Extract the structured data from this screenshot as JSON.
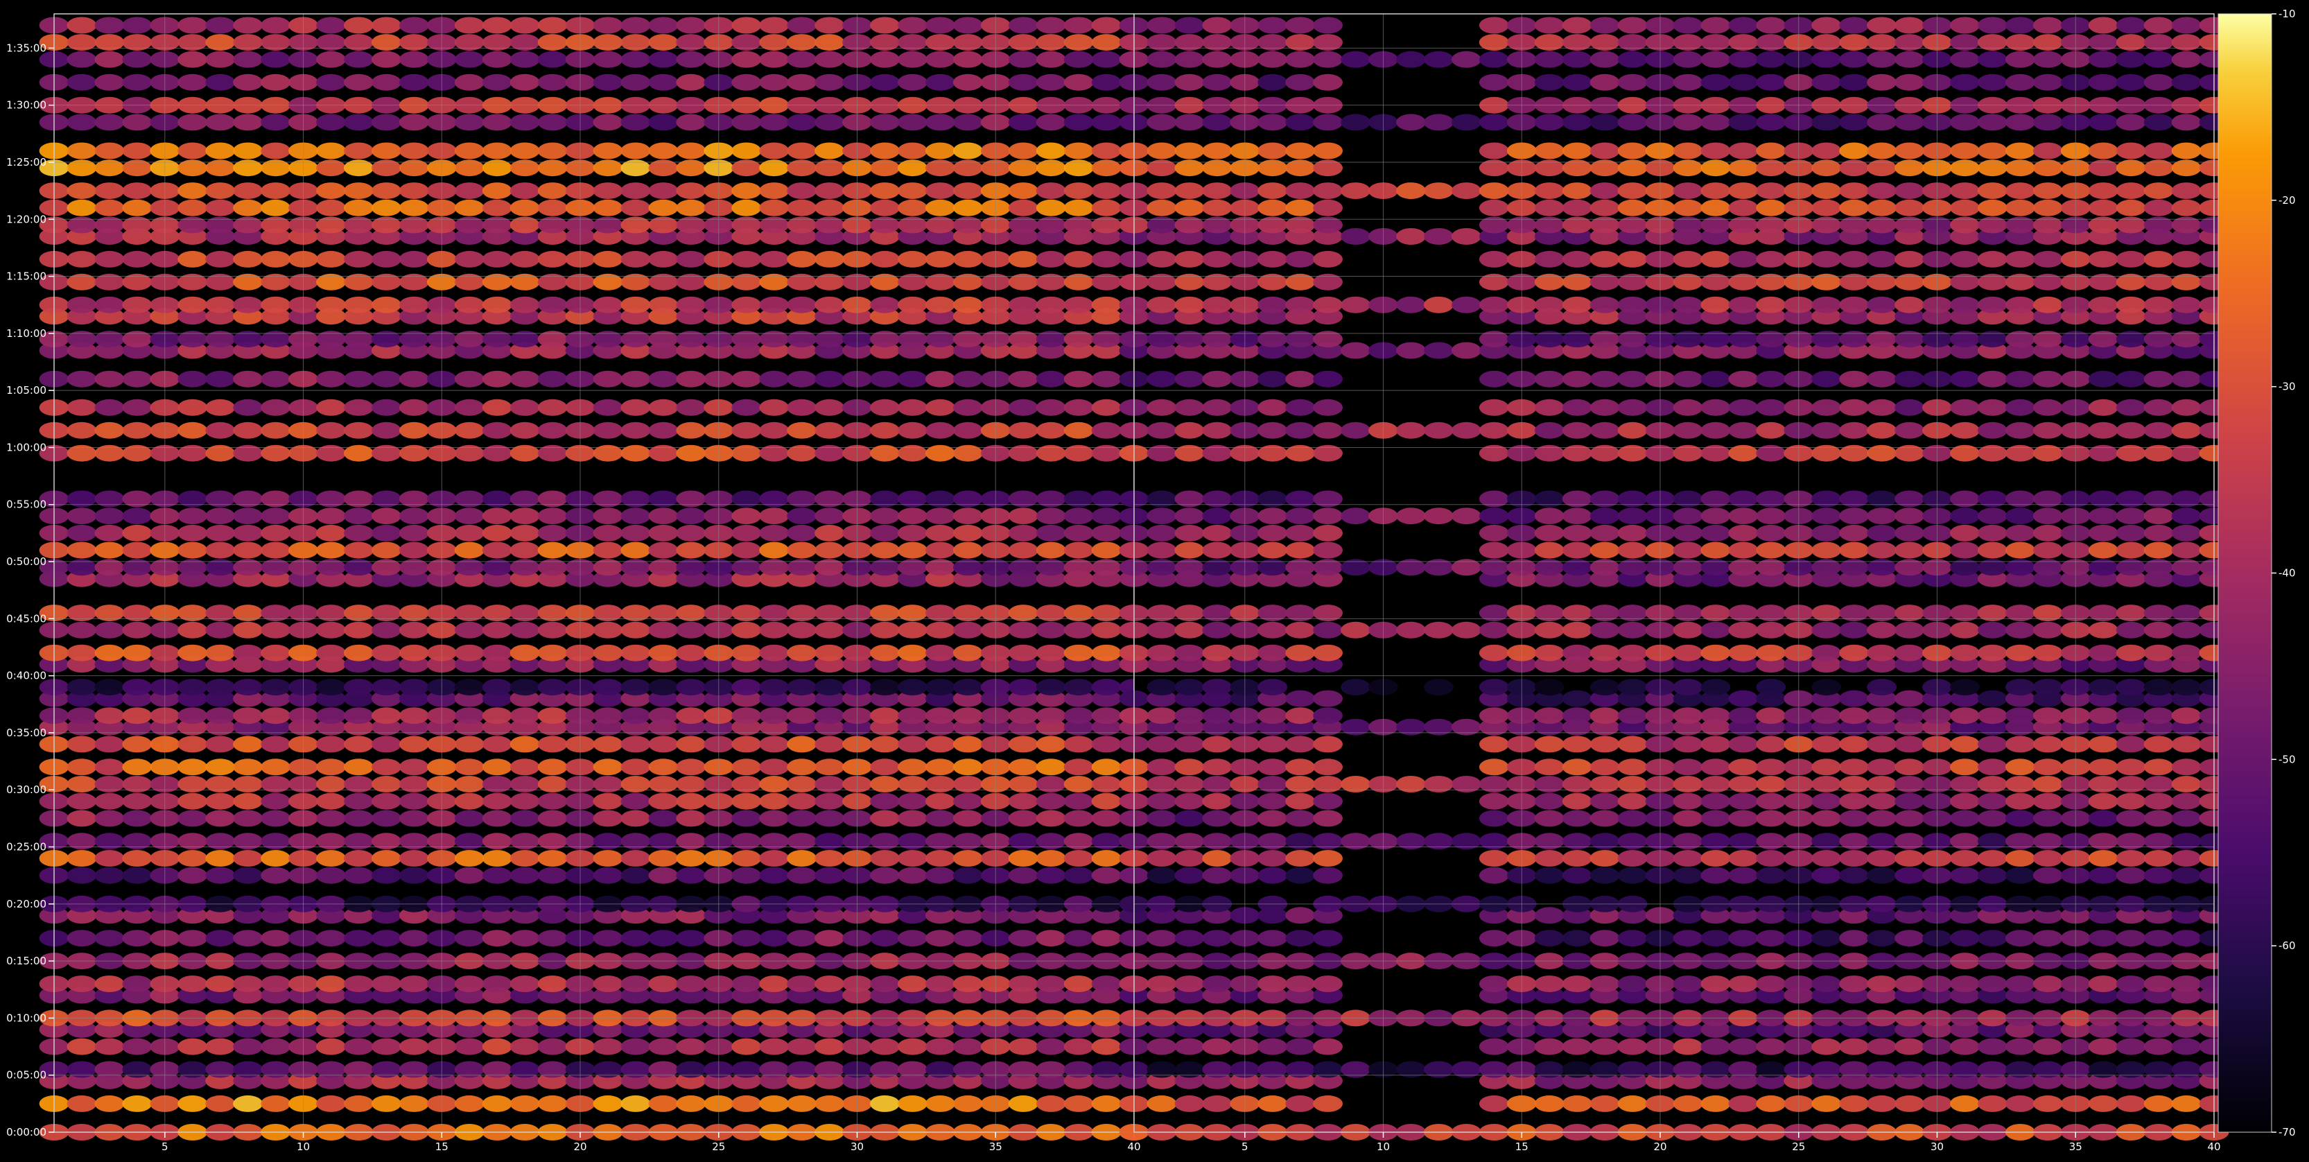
{
  "chart_data": {
    "type": "heatmap",
    "title": "",
    "colormap": "inferno",
    "background": "#000000",
    "grid": true,
    "xlabel": "",
    "ylabel": "",
    "panels": [
      {
        "name": "",
        "xlim": [
          1,
          40
        ],
        "xticks": [
          5,
          10,
          15,
          20,
          25,
          30,
          35,
          40
        ],
        "xtick_labels": [
          "5",
          "10",
          "15",
          "20",
          "25",
          "30",
          "35",
          "40"
        ]
      },
      {
        "name": "",
        "xlim": [
          1,
          40
        ],
        "xticks": [
          5,
          10,
          15,
          20,
          25,
          30,
          35,
          40
        ],
        "xtick_labels": [
          "5",
          "10",
          "15",
          "20",
          "25",
          "30",
          "35",
          "40"
        ]
      }
    ],
    "y_axis": {
      "unit": "time",
      "ylim_seconds": [
        0,
        5880
      ],
      "ticks_seconds": [
        0,
        300,
        600,
        900,
        1200,
        1500,
        1800,
        2100,
        2400,
        2700,
        3000,
        3300,
        3600,
        3900,
        4200,
        4500,
        4800,
        5100,
        5400,
        5700
      ],
      "tick_labels": [
        "0:00:00",
        "0:05:00",
        "0:10:00",
        "0:15:00",
        "0:20:00",
        "0:25:00",
        "0:30:00",
        "0:35:00",
        "0:40:00",
        "0:45:00",
        "0:50:00",
        "0:55:00",
        "1:00:00",
        "1:05:00",
        "1:10:00",
        "1:15:00",
        "1:20:00",
        "1:25:00",
        "1:30:00",
        "1:35:00"
      ]
    },
    "colorbar": {
      "range": [
        -70,
        -10
      ],
      "ticks": [
        -70,
        -60,
        -50,
        -40,
        -30,
        -20,
        -10
      ],
      "tick_labels": [
        "-70",
        "-60",
        "-50",
        "-40",
        "-30",
        "-20",
        "-10"
      ],
      "location": "right"
    },
    "row_levels_panel1": [
      [
        0,
        -26
      ],
      [
        150,
        -22
      ],
      [
        270,
        -40
      ],
      [
        330,
        -52
      ],
      [
        450,
        -38
      ],
      [
        540,
        -46
      ],
      [
        600,
        -32
      ],
      [
        720,
        -46
      ],
      [
        780,
        -38
      ],
      [
        900,
        -42
      ],
      [
        1020,
        -48
      ],
      [
        1140,
        -46
      ],
      [
        1200,
        -58
      ],
      [
        1350,
        -52
      ],
      [
        1440,
        -28
      ],
      [
        1530,
        -48
      ],
      [
        1650,
        -44
      ],
      [
        1740,
        -38
      ],
      [
        1830,
        -34
      ],
      [
        1920,
        -28
      ],
      [
        2040,
        -32
      ],
      [
        2130,
        -44
      ],
      [
        2190,
        -40
      ],
      [
        2280,
        -50
      ],
      [
        2340,
        -60
      ],
      [
        2460,
        -44
      ],
      [
        2520,
        -32
      ],
      [
        2640,
        -38
      ],
      [
        2730,
        -34
      ],
      [
        2910,
        -42
      ],
      [
        2970,
        -46
      ],
      [
        3060,
        -30
      ],
      [
        3150,
        -40
      ],
      [
        3240,
        -44
      ],
      [
        3330,
        -50
      ],
      [
        3570,
        -32
      ],
      [
        3690,
        -34
      ],
      [
        3810,
        -40
      ],
      [
        3960,
        -46
      ],
      [
        4110,
        -42
      ],
      [
        4170,
        -46
      ],
      [
        4290,
        -36
      ],
      [
        4350,
        -36
      ],
      [
        4470,
        -30
      ],
      [
        4590,
        -34
      ],
      [
        4710,
        -40
      ],
      [
        4770,
        -38
      ],
      [
        4860,
        -26
      ],
      [
        4950,
        -30
      ],
      [
        5070,
        -22
      ],
      [
        5160,
        -24
      ],
      [
        5310,
        -48
      ],
      [
        5400,
        -36
      ],
      [
        5520,
        -46
      ],
      [
        5640,
        -46
      ],
      [
        5730,
        -34
      ],
      [
        5820,
        -40
      ]
    ],
    "row_levels_panel2": [
      [
        0,
        -32
      ],
      [
        150,
        -30
      ],
      [
        270,
        -44
      ],
      [
        330,
        -58
      ],
      [
        450,
        -42
      ],
      [
        540,
        -50
      ],
      [
        600,
        -40
      ],
      [
        720,
        -50
      ],
      [
        780,
        -44
      ],
      [
        900,
        -46
      ],
      [
        1020,
        -54
      ],
      [
        1140,
        -50
      ],
      [
        1200,
        -62
      ],
      [
        1350,
        -56
      ],
      [
        1440,
        -34
      ],
      [
        1530,
        -52
      ],
      [
        1650,
        -48
      ],
      [
        1740,
        -42
      ],
      [
        1830,
        -38
      ],
      [
        1920,
        -34
      ],
      [
        2040,
        -36
      ],
      [
        2130,
        -48
      ],
      [
        2190,
        -44
      ],
      [
        2280,
        -54
      ],
      [
        2340,
        -64
      ],
      [
        2460,
        -48
      ],
      [
        2520,
        -36
      ],
      [
        2640,
        -42
      ],
      [
        2730,
        -40
      ],
      [
        2910,
        -48
      ],
      [
        2970,
        -50
      ],
      [
        3060,
        -34
      ],
      [
        3150,
        -44
      ],
      [
        3240,
        -48
      ],
      [
        3330,
        -54
      ],
      [
        3570,
        -36
      ],
      [
        3690,
        -40
      ],
      [
        3810,
        -44
      ],
      [
        3960,
        -50
      ],
      [
        4110,
        -46
      ],
      [
        4170,
        -50
      ],
      [
        4290,
        -42
      ],
      [
        4350,
        -40
      ],
      [
        4470,
        -34
      ],
      [
        4590,
        -38
      ],
      [
        4710,
        -44
      ],
      [
        4770,
        -42
      ],
      [
        4860,
        -30
      ],
      [
        4950,
        -34
      ],
      [
        5070,
        -28
      ],
      [
        5160,
        -28
      ],
      [
        5310,
        -52
      ],
      [
        5400,
        -40
      ],
      [
        5520,
        -50
      ],
      [
        5640,
        -50
      ],
      [
        5730,
        -38
      ],
      [
        5820,
        -44
      ]
    ]
  }
}
